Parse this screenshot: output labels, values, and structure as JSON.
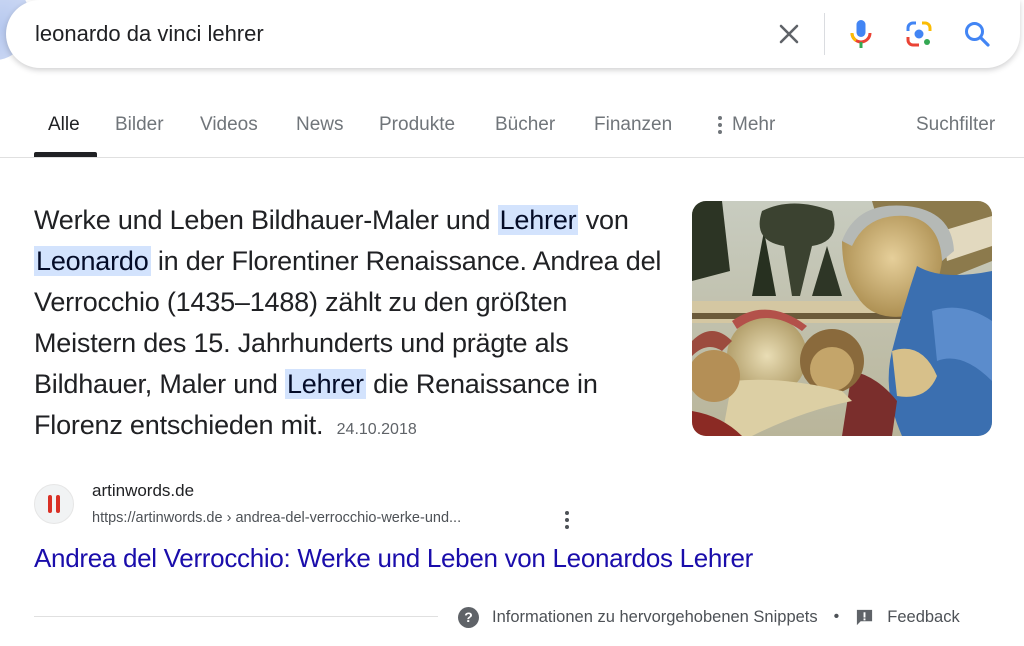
{
  "search": {
    "query": "leonardo da vinci lehrer",
    "icons": {
      "clear": "close-icon",
      "voice": "microphone-icon",
      "lens": "google-lens-icon",
      "search": "search-icon"
    }
  },
  "tabs": [
    {
      "label": "Alle",
      "active": true
    },
    {
      "label": "Bilder",
      "active": false
    },
    {
      "label": "Videos",
      "active": false
    },
    {
      "label": "News",
      "active": false
    },
    {
      "label": "Produkte",
      "active": false
    },
    {
      "label": "Bücher",
      "active": false
    },
    {
      "label": "Finanzen",
      "active": false
    },
    {
      "label": "Mehr",
      "active": false
    }
  ],
  "search_filter_label": "Suchfilter",
  "snippet": {
    "segments": [
      {
        "text": "Werke und Leben Bildhauer-Maler und ",
        "highlight": false
      },
      {
        "text": "Lehrer",
        "highlight": true
      },
      {
        "text": " von ",
        "highlight": false
      },
      {
        "text": "Leonardo",
        "highlight": true
      },
      {
        "text": " in der Florentiner Renaissance. Andrea del Verrocchio (1435–1488) zählt zu den größten Meistern des 15. Jahrhunderts und prägte als Bildhauer, Maler und ",
        "highlight": false
      },
      {
        "text": "Lehrer",
        "highlight": true
      },
      {
        "text": " die Renaissance in Florenz entschieden mit.",
        "highlight": false
      }
    ],
    "date": "24.10.2018",
    "image_alt": "Madonna painting thumbnail"
  },
  "source": {
    "site_name": "artinwords.de",
    "url": "https://artinwords.de › andrea-del-verrocchio-werke-und...",
    "favicon_color": "#d93025",
    "title": "Andrea del Verrocchio: Werke und Leben von Leonardos Lehrer"
  },
  "footer": {
    "about_label": "Informationen zu hervorgehobenen Snippets",
    "separator": "•",
    "feedback_label": "Feedback"
  },
  "colors": {
    "link": "#1a0dab",
    "highlight_bg": "#d3e3fd",
    "text": "#202124",
    "muted": "#70757a"
  }
}
